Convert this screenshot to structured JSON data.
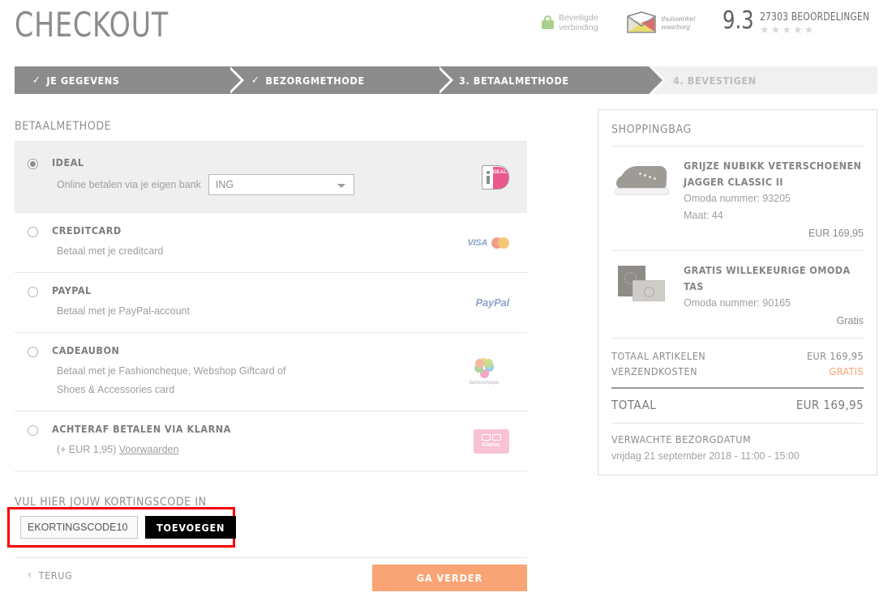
{
  "header": {
    "title": "CHECKOUT",
    "secure_badge": {
      "line1": "Beveiligde",
      "line2": "verbinding",
      "icon": "lock-icon"
    },
    "thuiswinkel": {
      "line1": "thuiswinkel",
      "line2": "waarborg",
      "icon": "envelope-icon"
    },
    "rating": {
      "score": "9.3",
      "count_label": "27303 BEOORDELINGEN",
      "stars": "★★★★★"
    }
  },
  "steps": [
    {
      "label": "JE GEGEVENS",
      "check": "✓",
      "state": "completed"
    },
    {
      "label": "BEZORGMETHODE",
      "check": "✓",
      "state": "completed"
    },
    {
      "label": "3. BETAALMETHODE",
      "check": "",
      "state": "active"
    },
    {
      "label": "4. BEVESTIGEN",
      "check": "",
      "state": "upcoming"
    }
  ],
  "payment": {
    "section_title": "BETAALMETHODE",
    "methods": [
      {
        "name": "IDEAL",
        "description": "Online betalen via je eigen bank",
        "selected": true,
        "bank_select": {
          "value": "ING",
          "icon": "chevron-down-icon"
        },
        "logo": "ideal-logo",
        "logo_text": "iDEAL"
      },
      {
        "name": "CREDITCARD",
        "description": "Betaal met je creditcard",
        "selected": false,
        "logo": "visa-mastercard-logo",
        "logo_text": "VISA"
      },
      {
        "name": "PAYPAL",
        "description": "Betaal met je PayPal-account",
        "selected": false,
        "logo": "paypal-logo",
        "logo_text": "PayPal"
      },
      {
        "name": "CADEAUBON",
        "description": "Betaal met je Fashioncheque, Webshop Giftcard of Shoes & Accessories card",
        "selected": false,
        "logo": "fashioncheque-logo",
        "logo_text": "fashioncheque"
      },
      {
        "name": "ACHTERAF BETALEN VIA KLARNA",
        "description": "(+ EUR 1,95) ",
        "link_label": "Voorwaarden",
        "selected": false,
        "logo": "klarna-logo",
        "logo_text": "Klarna."
      }
    ]
  },
  "discount": {
    "title": "VUL HIER JOUW KORTINGSCODE IN",
    "input_value": "EKORTINGSCODE10",
    "placeholder": "Kortingscode",
    "button_label": "TOEVOEGEN",
    "highlight_color": "#fb0000"
  },
  "nav": {
    "back_label": "TERUG",
    "back_icon": "chevron-left-icon",
    "continue_label": "GA VERDER",
    "continue_color": "#f9a475"
  },
  "shoppingbag": {
    "title": "SHOPPINGBAG",
    "items": [
      {
        "name": "GRIJZE NUBIKK VETERSCHOENEN JAGGER CLASSIC II",
        "number_label": "Omoda nummer: 93205",
        "size_label": "Maat: 44",
        "price": "EUR 169,95",
        "thumb": "shoe-thumbnail"
      },
      {
        "name": "GRATIS WILLEKEURIGE OMODA TAS",
        "number_label": "Omoda nummer: 90165",
        "size_label": "",
        "price": "Gratis",
        "thumb": "bag-thumbnail"
      }
    ],
    "totals": [
      {
        "label": "TOTAAL ARTIKELEN",
        "value": "EUR 169,95",
        "free": false
      },
      {
        "label": "VERZENDKOSTEN",
        "value": "GRATIS",
        "free": true
      }
    ],
    "grand_total": {
      "label": "TOTAAL",
      "value": "EUR 169,95"
    },
    "delivery": {
      "title": "VERWACHTE BEZORGDATUM",
      "date": "vrijdag 21 september 2018 - 11:00 - 15:00"
    }
  }
}
